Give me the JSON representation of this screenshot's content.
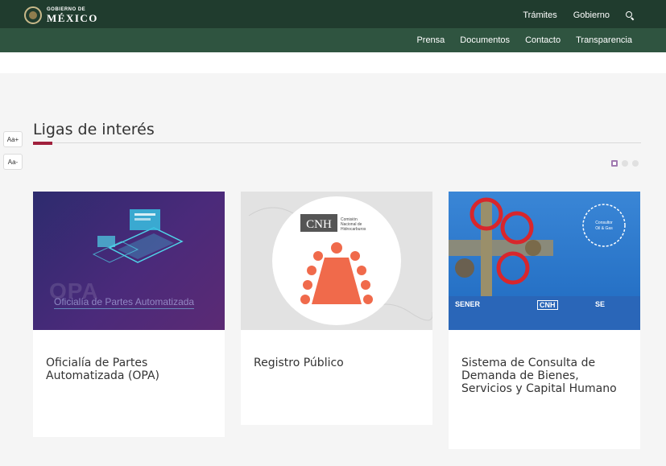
{
  "header": {
    "logo_small": "GOBIERNO DE",
    "logo_big": "MÉXICO",
    "top_links": [
      "Trámites",
      "Gobierno"
    ],
    "sub_links": [
      "Prensa",
      "Documentos",
      "Contacto",
      "Transparencia"
    ]
  },
  "font_controls": {
    "increase": "Aa+",
    "decrease": "Aa-"
  },
  "section": {
    "title": "Ligas de interés"
  },
  "carousel": {
    "pages": 3,
    "active": 1
  },
  "cards": [
    {
      "title": "Oficialía de Partes Automatizada (OPA)",
      "image_watermark": "OPA",
      "image_caption": "Oficialía de Partes Automatizada"
    },
    {
      "title": "Registro Público",
      "image_logo": "CNH",
      "image_logo_caption": "Comisión Nacional de Hidrocarburos"
    },
    {
      "title": "Sistema de Consulta de Demanda de Bienes, Servicios y Capital Humano",
      "image_badge": "Consultor Oil & Gas",
      "image_logos": [
        "SENER",
        "CNH",
        "SE"
      ]
    }
  ],
  "colors": {
    "header_dark": "#203c2e",
    "header_light": "#2f5440",
    "accent": "#a0203c"
  }
}
